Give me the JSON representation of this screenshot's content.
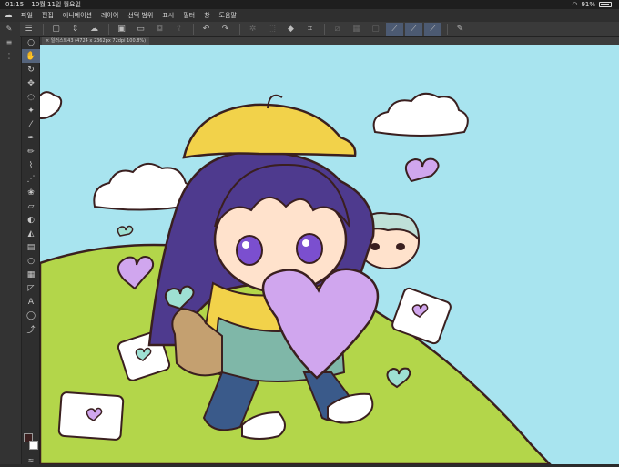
{
  "status_bar": {
    "time": "01:15",
    "date": "10월 11일 월요일",
    "battery": "91%",
    "battery_level": 0.91
  },
  "menu": {
    "items": [
      "파일",
      "편집",
      "애니메이션",
      "레이어",
      "선택 범위",
      "표시",
      "필터",
      "창",
      "도움말"
    ]
  },
  "document": {
    "tab_label": "일러스트43 (4724 x 2362px 72dpi 100.8%)"
  },
  "toolbar": {
    "icons": [
      "menu-icon",
      "new-file-icon",
      "stepper-icon",
      "cloud-icon",
      "undo-list-icon",
      "folder-icon",
      "save-icon",
      "export-icon",
      "undo-icon",
      "redo-icon",
      "settings-icon",
      "transform-icon",
      "fill-icon",
      "crop-icon",
      "blank-icon",
      "deselect-icon",
      "select-icon",
      "pen-stroke-icon",
      "pen-stroke-2-icon",
      "pen-stroke-3-icon",
      "edit-icon"
    ]
  },
  "tools": [
    "zoom-icon",
    "hand-icon",
    "rotate-icon",
    "move-icon",
    "lasso-icon",
    "wand-icon",
    "eyedropper-icon",
    "pen-icon",
    "pencil-icon",
    "brush-icon",
    "airbrush-icon",
    "decoration-icon",
    "eraser-icon",
    "blend-icon",
    "fill-icon",
    "gradient-icon",
    "shape-icon",
    "frame-icon",
    "ruler-icon",
    "text-icon",
    "balloon-icon",
    "correction-icon"
  ],
  "colors": {
    "main_color": "#3a1f1f",
    "sub_color": "#ffffff",
    "sky": "#a8e4ef",
    "grass": "#b3d64a",
    "hair": "#4e3a8e",
    "hat": "#f2d24a",
    "heart": "#d0a6ee"
  }
}
